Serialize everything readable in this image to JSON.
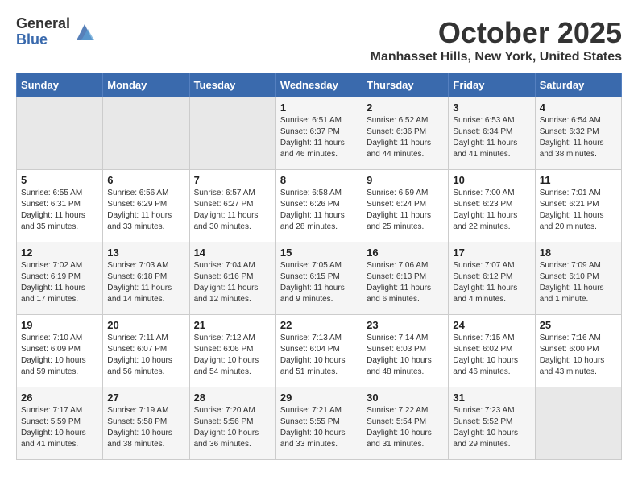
{
  "header": {
    "logo_general": "General",
    "logo_blue": "Blue",
    "month_title": "October 2025",
    "location": "Manhasset Hills, New York, United States"
  },
  "days_of_week": [
    "Sunday",
    "Monday",
    "Tuesday",
    "Wednesday",
    "Thursday",
    "Friday",
    "Saturday"
  ],
  "weeks": [
    [
      {
        "day": "",
        "info": ""
      },
      {
        "day": "",
        "info": ""
      },
      {
        "day": "",
        "info": ""
      },
      {
        "day": "1",
        "info": "Sunrise: 6:51 AM\nSunset: 6:37 PM\nDaylight: 11 hours\nand 46 minutes."
      },
      {
        "day": "2",
        "info": "Sunrise: 6:52 AM\nSunset: 6:36 PM\nDaylight: 11 hours\nand 44 minutes."
      },
      {
        "day": "3",
        "info": "Sunrise: 6:53 AM\nSunset: 6:34 PM\nDaylight: 11 hours\nand 41 minutes."
      },
      {
        "day": "4",
        "info": "Sunrise: 6:54 AM\nSunset: 6:32 PM\nDaylight: 11 hours\nand 38 minutes."
      }
    ],
    [
      {
        "day": "5",
        "info": "Sunrise: 6:55 AM\nSunset: 6:31 PM\nDaylight: 11 hours\nand 35 minutes."
      },
      {
        "day": "6",
        "info": "Sunrise: 6:56 AM\nSunset: 6:29 PM\nDaylight: 11 hours\nand 33 minutes."
      },
      {
        "day": "7",
        "info": "Sunrise: 6:57 AM\nSunset: 6:27 PM\nDaylight: 11 hours\nand 30 minutes."
      },
      {
        "day": "8",
        "info": "Sunrise: 6:58 AM\nSunset: 6:26 PM\nDaylight: 11 hours\nand 28 minutes."
      },
      {
        "day": "9",
        "info": "Sunrise: 6:59 AM\nSunset: 6:24 PM\nDaylight: 11 hours\nand 25 minutes."
      },
      {
        "day": "10",
        "info": "Sunrise: 7:00 AM\nSunset: 6:23 PM\nDaylight: 11 hours\nand 22 minutes."
      },
      {
        "day": "11",
        "info": "Sunrise: 7:01 AM\nSunset: 6:21 PM\nDaylight: 11 hours\nand 20 minutes."
      }
    ],
    [
      {
        "day": "12",
        "info": "Sunrise: 7:02 AM\nSunset: 6:19 PM\nDaylight: 11 hours\nand 17 minutes."
      },
      {
        "day": "13",
        "info": "Sunrise: 7:03 AM\nSunset: 6:18 PM\nDaylight: 11 hours\nand 14 minutes."
      },
      {
        "day": "14",
        "info": "Sunrise: 7:04 AM\nSunset: 6:16 PM\nDaylight: 11 hours\nand 12 minutes."
      },
      {
        "day": "15",
        "info": "Sunrise: 7:05 AM\nSunset: 6:15 PM\nDaylight: 11 hours\nand 9 minutes."
      },
      {
        "day": "16",
        "info": "Sunrise: 7:06 AM\nSunset: 6:13 PM\nDaylight: 11 hours\nand 6 minutes."
      },
      {
        "day": "17",
        "info": "Sunrise: 7:07 AM\nSunset: 6:12 PM\nDaylight: 11 hours\nand 4 minutes."
      },
      {
        "day": "18",
        "info": "Sunrise: 7:09 AM\nSunset: 6:10 PM\nDaylight: 11 hours\nand 1 minute."
      }
    ],
    [
      {
        "day": "19",
        "info": "Sunrise: 7:10 AM\nSunset: 6:09 PM\nDaylight: 10 hours\nand 59 minutes."
      },
      {
        "day": "20",
        "info": "Sunrise: 7:11 AM\nSunset: 6:07 PM\nDaylight: 10 hours\nand 56 minutes."
      },
      {
        "day": "21",
        "info": "Sunrise: 7:12 AM\nSunset: 6:06 PM\nDaylight: 10 hours\nand 54 minutes."
      },
      {
        "day": "22",
        "info": "Sunrise: 7:13 AM\nSunset: 6:04 PM\nDaylight: 10 hours\nand 51 minutes."
      },
      {
        "day": "23",
        "info": "Sunrise: 7:14 AM\nSunset: 6:03 PM\nDaylight: 10 hours\nand 48 minutes."
      },
      {
        "day": "24",
        "info": "Sunrise: 7:15 AM\nSunset: 6:02 PM\nDaylight: 10 hours\nand 46 minutes."
      },
      {
        "day": "25",
        "info": "Sunrise: 7:16 AM\nSunset: 6:00 PM\nDaylight: 10 hours\nand 43 minutes."
      }
    ],
    [
      {
        "day": "26",
        "info": "Sunrise: 7:17 AM\nSunset: 5:59 PM\nDaylight: 10 hours\nand 41 minutes."
      },
      {
        "day": "27",
        "info": "Sunrise: 7:19 AM\nSunset: 5:58 PM\nDaylight: 10 hours\nand 38 minutes."
      },
      {
        "day": "28",
        "info": "Sunrise: 7:20 AM\nSunset: 5:56 PM\nDaylight: 10 hours\nand 36 minutes."
      },
      {
        "day": "29",
        "info": "Sunrise: 7:21 AM\nSunset: 5:55 PM\nDaylight: 10 hours\nand 33 minutes."
      },
      {
        "day": "30",
        "info": "Sunrise: 7:22 AM\nSunset: 5:54 PM\nDaylight: 10 hours\nand 31 minutes."
      },
      {
        "day": "31",
        "info": "Sunrise: 7:23 AM\nSunset: 5:52 PM\nDaylight: 10 hours\nand 29 minutes."
      },
      {
        "day": "",
        "info": ""
      }
    ]
  ]
}
